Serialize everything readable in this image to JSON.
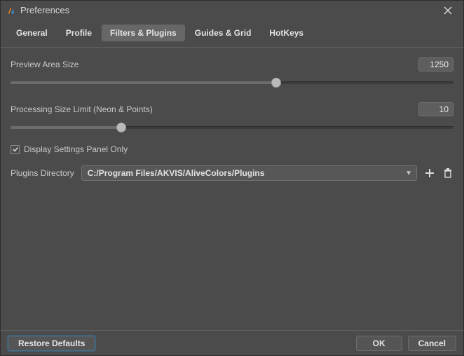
{
  "window": {
    "title": "Preferences"
  },
  "tabs": {
    "general": "General",
    "profile": "Profile",
    "filters": "Filters & Plugins",
    "guides": "Guides & Grid",
    "hotkeys": "HotKeys",
    "active": "filters"
  },
  "filters_plugins": {
    "preview_label": "Preview Area Size",
    "preview_value": "1250",
    "preview_slider_percent": 60,
    "processing_label": "Processing Size Limit (Neon & Points)",
    "processing_value": "10",
    "processing_slider_percent": 25,
    "display_settings_checked": true,
    "display_settings_label": "Display Settings Panel Only",
    "plugins_dir_label": "Plugins Directory",
    "plugins_dir_value": "C:/Program Files/AKVIS/AliveColors/Plugins"
  },
  "footer": {
    "restore": "Restore Defaults",
    "ok": "OK",
    "cancel": "Cancel"
  }
}
